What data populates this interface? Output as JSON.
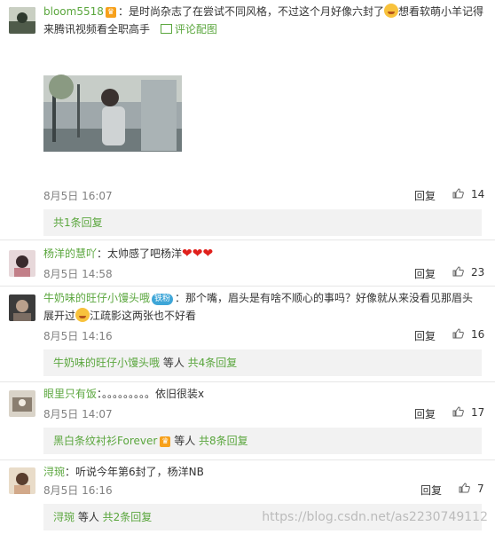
{
  "comments": [
    {
      "user": "bloom5518",
      "text_line1": "：是时尚杂志了在尝试不同风格，不过这个月好像六封了",
      "text_line1b": "想看软萌小羊记得",
      "text_line2": "来腾讯视频看全职高手",
      "view_pic": "评论配图",
      "time": "8月5日 16:07",
      "reply_label": "回复",
      "likes": "14",
      "sub": {
        "link": "共1条回复",
        "extra": ""
      }
    },
    {
      "user": "杨洋的慧吖",
      "text": "：太帅感了吧杨洋",
      "time": "8月5日 14:58",
      "reply_label": "回复",
      "likes": "23"
    },
    {
      "user": "牛奶味的旺仔小馒头哦",
      "fans_badge": "铁粉",
      "text_line1": "：那个嘴，眉头是有啥不顺心的事吗？好像就从来没看见那眉头",
      "text_line2a": "展开过",
      "text_line2b": "江疏影这两张也不好看",
      "time": "8月5日 14:16",
      "reply_label": "回复",
      "likes": "16",
      "sub": {
        "name": "牛奶味的旺仔小馒头哦",
        "mid": " 等人 ",
        "link": "共4条回复"
      }
    },
    {
      "user": "眼里只有饭",
      "text": "：。。。。。。。。。依旧很装x",
      "time": "8月5日 14:07",
      "reply_label": "回复",
      "likes": "17",
      "sub": {
        "name": "黑白条纹衬衫Forever",
        "mid": " 等人 ",
        "link": "共8条回复"
      }
    },
    {
      "user": "浔琬",
      "text": "：听说今年第6封了，杨洋NB",
      "time": "8月5日 16:16",
      "reply_label": "回复",
      "likes": "7",
      "sub": {
        "name": "浔琬",
        "mid": " 等人 ",
        "link": "共2条回复"
      }
    }
  ],
  "watermark": "https://blog.csdn.net/as2230749112"
}
